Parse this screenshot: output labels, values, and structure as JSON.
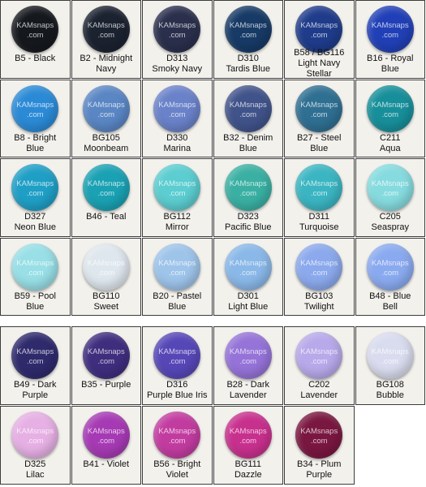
{
  "watermark": "KAMsnaps\n.com",
  "sections": [
    {
      "id": "blue",
      "swatches": [
        {
          "label": "B5 - Black",
          "color": "#15181d"
        },
        {
          "label": "B2 - Midnight\nNavy",
          "color": "#1b2230"
        },
        {
          "label": "D313\nSmoky Navy",
          "color": "#2a2f4c"
        },
        {
          "label": "D310\nTardis Blue",
          "color": "#173a66"
        },
        {
          "label": "B58 / BG116\nLight Navy\nStellar",
          "color": "#1f3c8b"
        },
        {
          "label": "B16 - Royal\nBlue",
          "color": "#2140b7"
        },
        {
          "label": "B8 - Bright\nBlue",
          "color": "#2b8ad6"
        },
        {
          "label": "BG105\nMoonbeam",
          "color": "#5a86c4"
        },
        {
          "label": "D330\nMarina",
          "color": "#6a82c9"
        },
        {
          "label": "B32 - Denim\nBlue",
          "color": "#40538a"
        },
        {
          "label": "B27 - Steel\nBlue",
          "color": "#2f6f92"
        },
        {
          "label": "C211\nAqua",
          "color": "#178f9a"
        },
        {
          "label": "D327\nNeon Blue",
          "color": "#1f9fc6"
        },
        {
          "label": "B46 - Teal",
          "color": "#1aa1b3"
        },
        {
          "label": "BG112\nMirror",
          "color": "#5ccdd0"
        },
        {
          "label": "D323\nPacific Blue",
          "color": "#3ab0a3"
        },
        {
          "label": "D311\nTurquoise",
          "color": "#3bb5c2"
        },
        {
          "label": "C205\nSeaspray",
          "color": "#86dbdf"
        },
        {
          "label": "B59 - Pool\nBlue",
          "color": "#98dfe6"
        },
        {
          "label": "BG110\nSweet",
          "color": "#dfe7ee"
        },
        {
          "label": "B20 - Pastel\nBlue",
          "color": "#9ec4ea"
        },
        {
          "label": "D301\nLight Blue",
          "color": "#8ab8e8"
        },
        {
          "label": "BG103\nTwilight",
          "color": "#8ba9ec"
        },
        {
          "label": "B48 - Blue\nBell",
          "color": "#8aaaf0"
        }
      ]
    },
    {
      "id": "purple",
      "swatches": [
        {
          "label": "B49 - Dark\nPurple",
          "color": "#2e2a6c"
        },
        {
          "label": "B35 - Purple",
          "color": "#3f2d7e"
        },
        {
          "label": "D316\nPurple Blue Iris",
          "color": "#5647b7"
        },
        {
          "label": "B28 - Dark\nLavender",
          "color": "#9573d8"
        },
        {
          "label": "C202\nLavender",
          "color": "#b8a9ea"
        },
        {
          "label": "BG108\nBubble",
          "color": "#d9dcee"
        },
        {
          "label": "D325\nLilac",
          "color": "#e6b0e4"
        },
        {
          "label": "B41 - Violet",
          "color": "#a63ab4"
        },
        {
          "label": "B56 - Bright\nViolet",
          "color": "#c23ca0"
        },
        {
          "label": "BG111\nDazzle",
          "color": "#c8308e"
        },
        {
          "label": "B34 - Plum\nPurple",
          "color": "#7a1740"
        }
      ]
    }
  ]
}
